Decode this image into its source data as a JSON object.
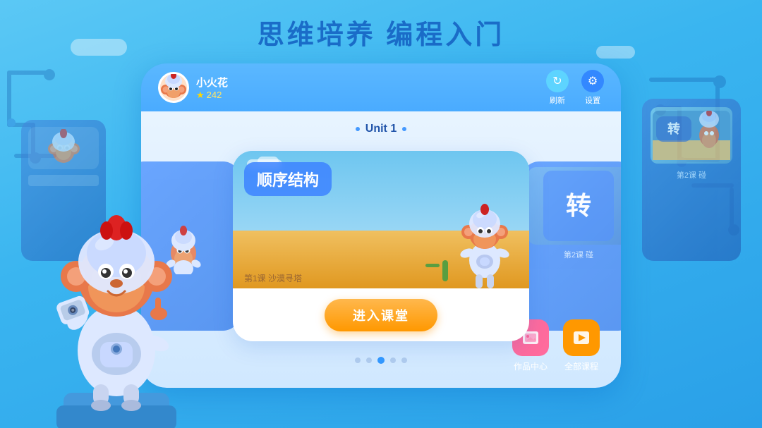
{
  "page": {
    "title": "思维培养 编程入门"
  },
  "user": {
    "name": "小火花",
    "score": "242",
    "score_label": "242"
  },
  "header": {
    "refresh_label": "刷新",
    "settings_label": "设置"
  },
  "unit": {
    "label": "Unit 1"
  },
  "card": {
    "scene_title": "顺序结构",
    "lesson_label": "第1课  沙漠寻塔",
    "enter_btn": "进入课堂"
  },
  "right_card": {
    "label": "转",
    "sub_label": "第2课 碰"
  },
  "left_card": {
    "has_monkey": true
  },
  "pagination": {
    "dots": [
      1,
      2,
      3,
      4,
      5
    ],
    "active_index": 2
  },
  "bottom_buttons": [
    {
      "label": "作品中心",
      "icon": "🖼️",
      "type": "works"
    },
    {
      "label": "全部课程",
      "icon": "▶",
      "type": "courses"
    }
  ],
  "icons": {
    "refresh": "↻",
    "settings": "⚙",
    "star": "★"
  }
}
